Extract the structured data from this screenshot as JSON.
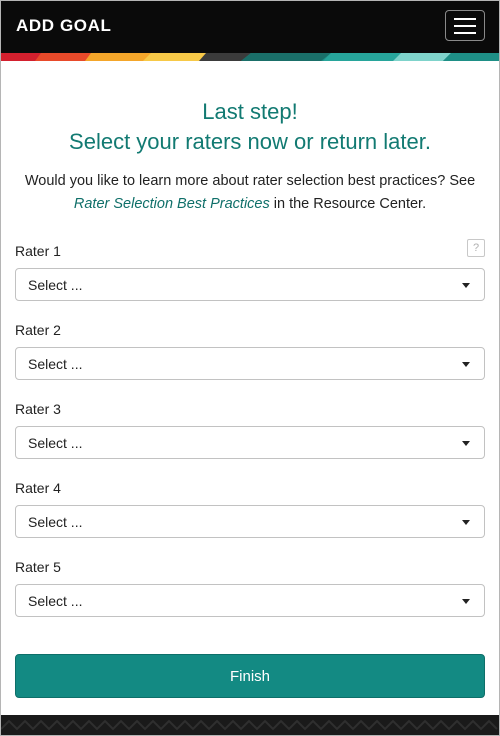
{
  "header": {
    "title": "ADD GOAL",
    "menu_icon": "hamburger-menu-icon"
  },
  "colors": {
    "teal": "#127a72",
    "button": "#138a83",
    "header_bg": "#0a0a0a"
  },
  "headline": {
    "line1": "Last step!",
    "line2": "Select your raters now or return later."
  },
  "intro": {
    "before": "Would you like to learn more about rater selection best practices? See ",
    "link": "Rater Selection Best Practices",
    "after": " in the Resource Center."
  },
  "help_label": "?",
  "raters": [
    {
      "label": "Rater 1",
      "value": "Select ..."
    },
    {
      "label": "Rater 2",
      "value": "Select ..."
    },
    {
      "label": "Rater 3",
      "value": "Select ..."
    },
    {
      "label": "Rater 4",
      "value": "Select ..."
    },
    {
      "label": "Rater 5",
      "value": "Select ..."
    }
  ],
  "finish_label": "Finish"
}
